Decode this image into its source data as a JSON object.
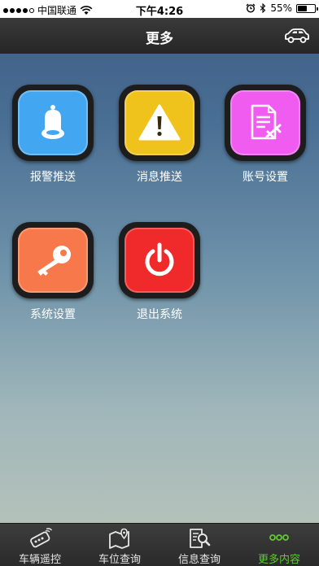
{
  "status_bar": {
    "carrier": "中国联通",
    "time": "下午4:26",
    "battery": "55%",
    "battery_level": 0.55
  },
  "nav": {
    "title": "更多",
    "car_icon": "car-icon"
  },
  "tiles": [
    {
      "label": "报警推送",
      "icon": "bell-icon",
      "color": "#42a7f0"
    },
    {
      "label": "消息推送",
      "icon": "warning-icon",
      "color": "#f0c21c"
    },
    {
      "label": "账号设置",
      "icon": "document-edit-icon",
      "color": "#f05cf0"
    },
    {
      "label": "系统设置",
      "icon": "key-icon",
      "color": "#f7784a"
    },
    {
      "label": "退出系统",
      "icon": "power-icon",
      "color": "#f0292a"
    }
  ],
  "tab_bar": {
    "items": [
      {
        "label": "车辆遥控",
        "icon": "remote-key-icon"
      },
      {
        "label": "车位查询",
        "icon": "map-pin-icon"
      },
      {
        "label": "信息查询",
        "icon": "document-search-icon"
      },
      {
        "label": "更多内容",
        "icon": "more-dots-icon"
      }
    ],
    "active_index": 3,
    "active_color": "#5fcb2e"
  }
}
